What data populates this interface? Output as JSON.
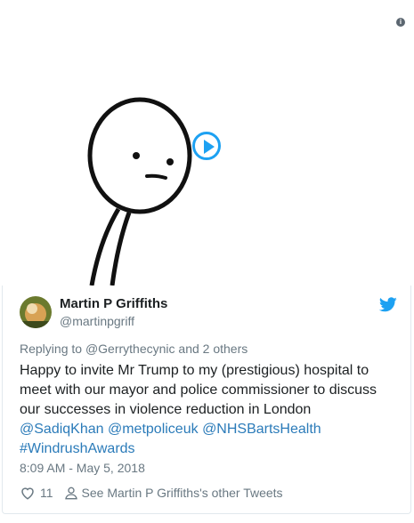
{
  "tweet": {
    "author_name": "Martin P Griffiths",
    "author_handle": "@martinpgriff",
    "replying_prefix": "Replying to ",
    "replying_to": "@Gerrythecynic",
    "replying_suffix": " and 2 others",
    "text_plain": "Happy to invite Mr Trump to my (prestigious) hospital to meet with our mayor and police commissioner to discuss our successes in violence reduction in London",
    "mentions": [
      "@SadiqKhan",
      "@metpoliceuk",
      "@NHSBartsHealth"
    ],
    "hashtag": "#WindrushAwards",
    "timestamp": "8:09 AM - May 5, 2018",
    "like_count": "11",
    "other_tweets_label": "See Martin P Griffiths's other Tweets"
  },
  "colors": {
    "link": "#2b7bb9",
    "muted": "#697882",
    "twitter_blue": "#1da1f2"
  },
  "icons": [
    "info-icon",
    "play-icon",
    "twitter-bird-icon",
    "heart-icon",
    "person-icon"
  ]
}
